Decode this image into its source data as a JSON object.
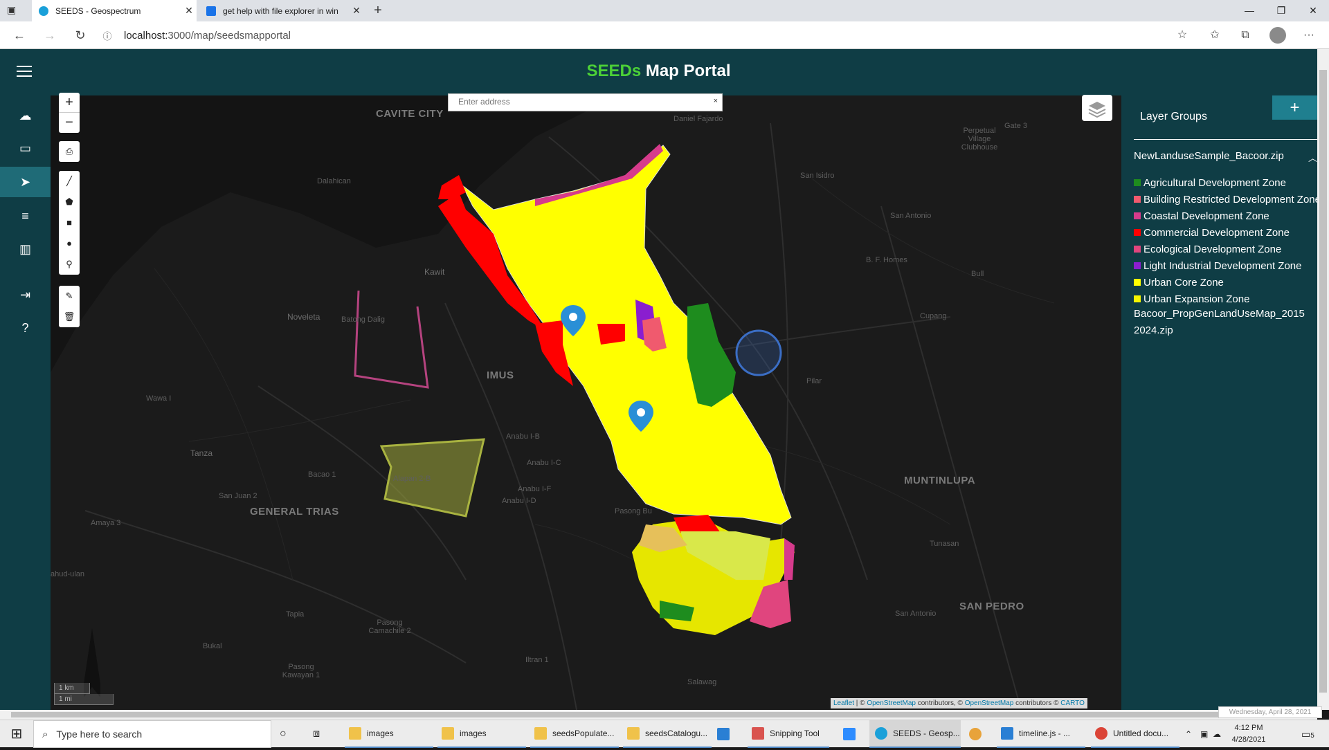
{
  "browser": {
    "tabs": [
      {
        "title": "SEEDS - Geospectrum",
        "active": true
      },
      {
        "title": "get help with file explorer in win",
        "active": false
      }
    ],
    "url": {
      "host": "localhost:",
      "rest": "3000/map/seedsmapportal"
    },
    "window_controls": [
      "—",
      "❐",
      "✕"
    ]
  },
  "app": {
    "title_accent": "SEEDs",
    "title_rest": " Map Portal",
    "accent_color": "#4cd137",
    "header_color": "#0f3d45"
  },
  "sidebar": {
    "items": [
      {
        "icon": "upload-cloud-icon",
        "glyph": "☁"
      },
      {
        "icon": "folder-icon",
        "glyph": "▭"
      },
      {
        "icon": "navigate-icon",
        "glyph": "➤"
      },
      {
        "icon": "filter-icon",
        "glyph": "≡"
      },
      {
        "icon": "bar-chart-icon",
        "glyph": "▥"
      },
      {
        "icon": "logout-icon",
        "glyph": "⇥"
      },
      {
        "icon": "help-icon",
        "glyph": "?"
      }
    ]
  },
  "map": {
    "search_placeholder": "Enter address",
    "search_clear": "×",
    "zoom_in": "+",
    "zoom_out": "−",
    "scale": {
      "metric": "1 km",
      "imperial": "1 mi"
    },
    "attribution": {
      "leaflet": "Leaflet",
      "sep1": " | © ",
      "osm1": "OpenStreetMap",
      "mid": " contributors, © ",
      "osm2": "OpenStreetMap",
      "mid2": " contributors © ",
      "carto": "CARTO"
    },
    "labels": [
      {
        "text": "CAVITE CITY",
        "cls": "big"
      },
      {
        "text": "Daniel Fajardo",
        "cls": "small"
      },
      {
        "text": "Perpetual Village Clubhouse",
        "cls": "small"
      },
      {
        "text": "Gate 3",
        "cls": "small"
      },
      {
        "text": "Dalahican",
        "cls": "small"
      },
      {
        "text": "San Isidro",
        "cls": "small"
      },
      {
        "text": "San Antonio",
        "cls": "small"
      },
      {
        "text": "Kawit",
        "cls": ""
      },
      {
        "text": "B. F. Homes",
        "cls": "small"
      },
      {
        "text": "Bull",
        "cls": "small"
      },
      {
        "text": "Noveleta",
        "cls": ""
      },
      {
        "text": "Batong Dalig",
        "cls": "small"
      },
      {
        "text": "Cupang",
        "cls": "small"
      },
      {
        "text": "IMUS",
        "cls": "big"
      },
      {
        "text": "Pilar",
        "cls": "small"
      },
      {
        "text": "Wawa I",
        "cls": "small"
      },
      {
        "text": "Anabu I-B",
        "cls": "small"
      },
      {
        "text": "Anabu I-C",
        "cls": "small"
      },
      {
        "text": "Tanza",
        "cls": ""
      },
      {
        "text": "Alapan 2-B",
        "cls": "small"
      },
      {
        "text": "Bacao 1",
        "cls": "small"
      },
      {
        "text": "MUNTINLUPA",
        "cls": "big"
      },
      {
        "text": "Anabu I-F",
        "cls": "small"
      },
      {
        "text": "Anabu I-D",
        "cls": "small"
      },
      {
        "text": "San Juan 2",
        "cls": "small"
      },
      {
        "text": "GENERAL TRIAS",
        "cls": "big"
      },
      {
        "text": "Pasong Bu",
        "cls": "small"
      },
      {
        "text": "Amaya 3",
        "cls": "small"
      },
      {
        "text": "Tunasan",
        "cls": "small"
      },
      {
        "text": "ahud-ulan",
        "cls": "small"
      },
      {
        "text": "Tapia",
        "cls": "small"
      },
      {
        "text": "San Antonio",
        "cls": "small"
      },
      {
        "text": "SAN PEDRO",
        "cls": "big"
      },
      {
        "text": "Pasong Camachile 2",
        "cls": "small"
      },
      {
        "text": "Bukal",
        "cls": "small"
      },
      {
        "text": "Iltran 1",
        "cls": "small"
      },
      {
        "text": "Pasong Kawayan 1",
        "cls": "small"
      },
      {
        "text": "Salawag",
        "cls": "small"
      }
    ]
  },
  "panel": {
    "title": "Layer Groups",
    "add": "+",
    "file1": "NewLanduseSample_Bacoor.zip",
    "file2_line1": "Bacoor_PropGenLandUseMap_2015",
    "file2_line2": "2024.zip",
    "legend": [
      {
        "label": "Agricultural Development Zone",
        "color": "#1e8c1e"
      },
      {
        "label": "Building Restricted Development Zone",
        "color": "#f05a6e"
      },
      {
        "label": "Coastal Development Zone",
        "color": "#d63b8c"
      },
      {
        "label": "Commercial Development Zone",
        "color": "#ff0000"
      },
      {
        "label": "Ecological Development Zone",
        "color": "#e0457e"
      },
      {
        "label": "Light Industrial Development Zone",
        "color": "#8a1ecf"
      },
      {
        "label": "Urban Core Zone",
        "color": "#ffff00"
      },
      {
        "label": "Urban Expansion Zone",
        "color": "#f5f500"
      }
    ]
  },
  "datetip": "Wednesday, April 28, 2021",
  "taskbar": {
    "search_placeholder": "Type here to search",
    "items": [
      {
        "label": "images",
        "color": "#f0c24a"
      },
      {
        "label": "images",
        "color": "#f0c24a"
      },
      {
        "label": "seedsPopulate...",
        "color": "#f0c24a"
      },
      {
        "label": "seedsCatalogu...",
        "color": "#f0c24a"
      },
      {
        "label": "Snipping Tool",
        "color": "#d9534f"
      },
      {
        "label": "SEEDS - Geosp...",
        "color": "#1aa0d9"
      },
      {
        "label": "timeline.js - ...",
        "color": "#2a7fd4"
      },
      {
        "label": "Untitled docu...",
        "color": "#db4437"
      }
    ],
    "time": "4:12 PM",
    "date": "4/28/2021",
    "notif": "5"
  }
}
